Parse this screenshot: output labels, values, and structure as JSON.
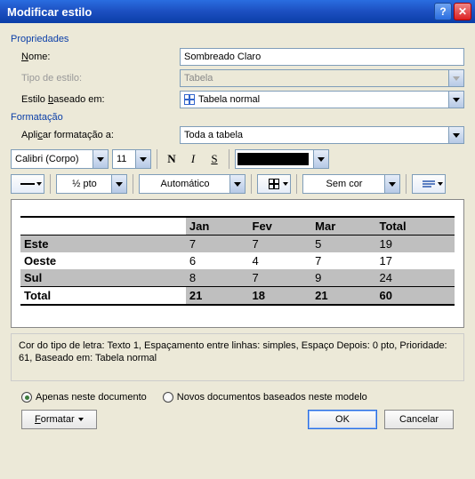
{
  "title": "Modificar estilo",
  "sections": {
    "properties_label": "Propriedades",
    "formatting_label": "Formatação"
  },
  "fields": {
    "name": {
      "label": "Nome:",
      "value": "Sombreado Claro"
    },
    "style_type": {
      "label": "Tipo de estilo:",
      "value": "Tabela"
    },
    "based_on": {
      "label": "Estilo baseado em:",
      "value": "Tabela normal"
    },
    "apply_to": {
      "label": "Aplicar formatação a:",
      "value": "Toda a tabela"
    }
  },
  "toolbar": {
    "font": "Calibri (Corpo)",
    "size": "11",
    "border_weight": "½ pto",
    "border_color": "Automático",
    "shading": "Sem cor"
  },
  "chart_data": {
    "type": "table",
    "columns": [
      "",
      "Jan",
      "Fev",
      "Mar",
      "Total"
    ],
    "rows": [
      {
        "label": "Este",
        "Jan": 7,
        "Fev": 7,
        "Mar": 5,
        "Total": 19
      },
      {
        "label": "Oeste",
        "Jan": 6,
        "Fev": 4,
        "Mar": 7,
        "Total": 17
      },
      {
        "label": "Sul",
        "Jan": 8,
        "Fev": 7,
        "Mar": 9,
        "Total": 24
      }
    ],
    "totals": {
      "label": "Total",
      "Jan": 21,
      "Fev": 18,
      "Mar": 21,
      "Total": 60
    }
  },
  "description": "Cor do tipo de letra: Texto 1, Espaçamento entre linhas:  simples, Espaço Depois:  0 pto, Prioridade: 61, Baseado em: Tabela normal",
  "radios": {
    "this_doc": "Apenas neste documento",
    "new_docs": "Novos documentos baseados neste modelo"
  },
  "buttons": {
    "format": "Formatar",
    "ok": "OK",
    "cancel": "Cancelar"
  }
}
